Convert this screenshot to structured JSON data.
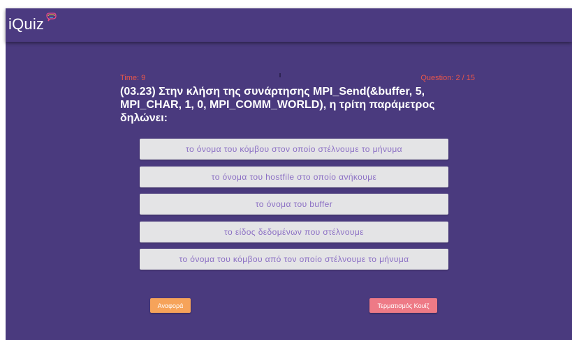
{
  "app": {
    "brand": "iQuiz",
    "logo_icon": "speech-bubble-logo-icon"
  },
  "quiz": {
    "time_label": "Time: 9",
    "question_counter": "Question: 2 / 15",
    "question_text": "(03.23) Στην κλήση της συνάρτησης MPI_Send(&buffer, 5, MPI_CHAR, 1, 0, MPI_COMM_WORLD), η τρίτη παράμετρος δηλώνει:",
    "answers": [
      "το όνομα του κόμβου στον οποίο στέλνουμε το μήνυμα",
      "το όνομα του hostfile στο οποίο ανήκουμε",
      "το όνομα του buffer",
      "το είδος δεδομένων που στέλνουμε",
      "το όνομα του κόμβου από τον οποίο στέλνουμε το μήνυμα"
    ]
  },
  "actions": {
    "report_label": "Αναφορά",
    "end_quiz_label": "Τερματισμός Κουίζ"
  },
  "colors": {
    "background": "#4a3a7e",
    "answer_bg": "#e4e4e6",
    "answer_text": "#8b6fc4",
    "meta_text": "#e8564b",
    "report_button": "#f6a35a",
    "end_button": "#ee7a86"
  }
}
